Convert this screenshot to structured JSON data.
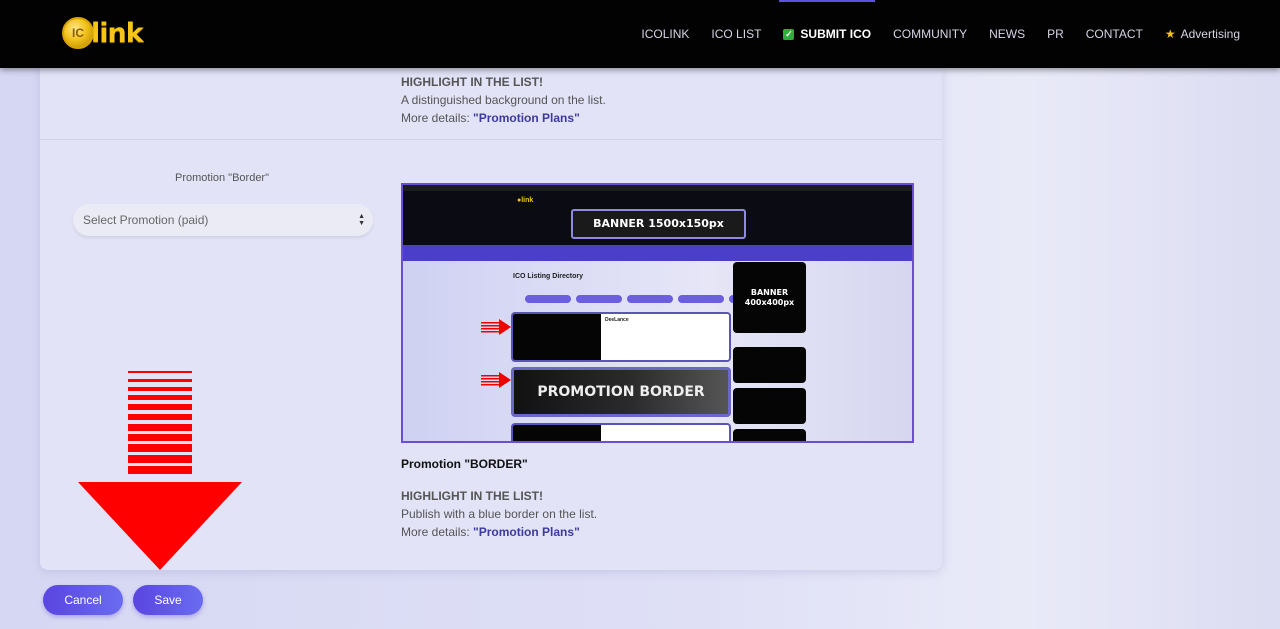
{
  "header": {
    "logo_text": "link",
    "logo_coin": "IC",
    "nav": [
      {
        "label": "ICOLINK",
        "active": false
      },
      {
        "label": "ICO LIST",
        "active": false
      },
      {
        "label": "SUBMIT ICO",
        "active": true,
        "icon": "check-icon"
      },
      {
        "label": "COMMUNITY",
        "active": false
      },
      {
        "label": "NEWS",
        "active": false
      },
      {
        "label": "PR",
        "active": false
      },
      {
        "label": "CONTACT",
        "active": false
      },
      {
        "label": "Advertising",
        "active": false,
        "icon": "star-icon"
      }
    ]
  },
  "section_highlight": {
    "heading": "HIGHLIGHT IN THE LIST!",
    "description": "A distinguished background on the list.",
    "more_prefix": "More details: ",
    "more_link": "\"Promotion Plans\""
  },
  "section_border": {
    "field_label": "Promotion \"Border\"",
    "select_value": "Select Promotion (paid)",
    "preview": {
      "banner_top": "BANNER 1500x150px",
      "listing_title": "ICO Listing Directory",
      "side_banner": "BANNER 400x400px",
      "side_banner_line1": "BANNER",
      "side_banner_line2": "400x400px",
      "promo_text": "PROMOTION BORDER",
      "entry_name": "DeeLance"
    },
    "caption": "Promotion \"BORDER\"",
    "heading": "HIGHLIGHT IN THE LIST!",
    "description": "Publish with a blue border on the list.",
    "more_prefix": "More details: ",
    "more_link": "\"Promotion Plans\""
  },
  "actions": {
    "cancel_label": "Cancel",
    "save_label": "Save"
  },
  "colors": {
    "accent": "#5b52e0",
    "annotation": "#ff0000",
    "logo": "#f5c518"
  }
}
